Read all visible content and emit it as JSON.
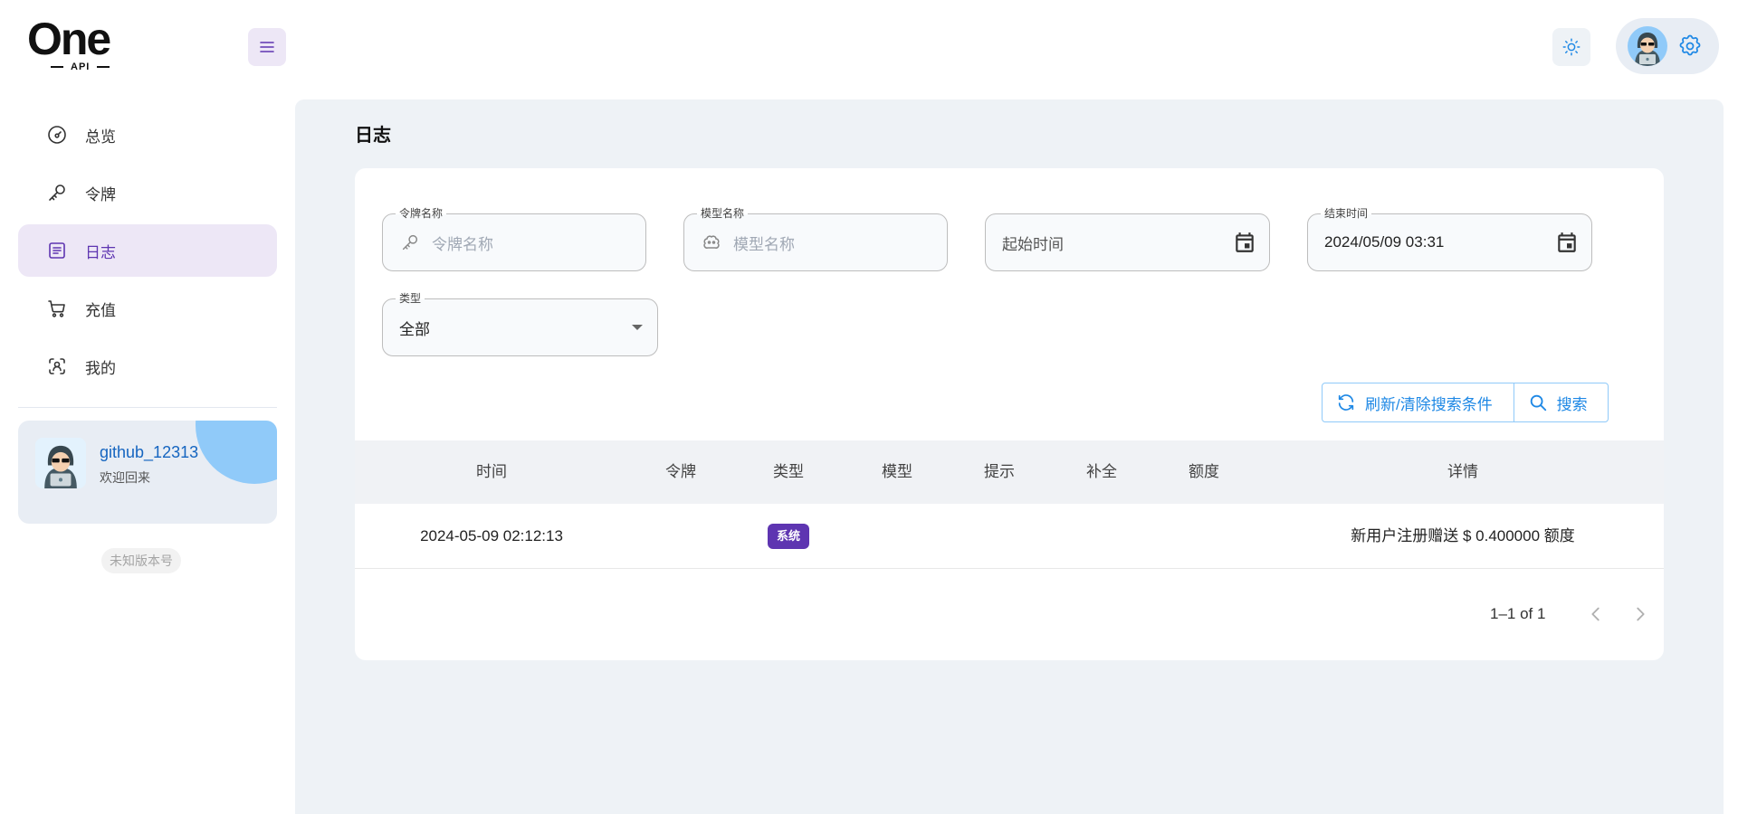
{
  "brand": {
    "logo_main": "One",
    "logo_sub": "API"
  },
  "header": {
    "menu_icon": "hamburger-menu-icon",
    "theme_icon": "sun-icon",
    "settings_icon": "gear-icon"
  },
  "sidebar": {
    "items": [
      {
        "label": "总览",
        "icon": "dashboard-gauge-icon",
        "active": false
      },
      {
        "label": "令牌",
        "icon": "key-icon",
        "active": false
      },
      {
        "label": "日志",
        "icon": "article-list-icon",
        "active": true
      },
      {
        "label": "充值",
        "icon": "shopping-cart-icon",
        "active": false
      },
      {
        "label": "我的",
        "icon": "user-scan-icon",
        "active": false
      }
    ],
    "user": {
      "name": "github_12313",
      "subtitle": "欢迎回来"
    },
    "version": "未知版本号"
  },
  "page": {
    "title": "日志"
  },
  "filters": {
    "token_name": {
      "label": "令牌名称",
      "placeholder": "令牌名称"
    },
    "model_name": {
      "label": "模型名称",
      "placeholder": "模型名称"
    },
    "start_time": {
      "placeholder": "起始时间"
    },
    "end_time": {
      "label": "结束时间",
      "value": "2024/05/09 03:31"
    },
    "type": {
      "label": "类型",
      "value": "全部"
    }
  },
  "actions": {
    "refresh_label": "刷新/清除搜索条件",
    "search_label": "搜索"
  },
  "table": {
    "columns": [
      "时间",
      "令牌",
      "类型",
      "模型",
      "提示",
      "补全",
      "额度",
      "详情"
    ],
    "rows": [
      {
        "time": "2024-05-09 02:12:13",
        "token": "",
        "type": "系统",
        "model": "",
        "prompt": "",
        "completion": "",
        "quota": "",
        "detail": "新用户注册赠送 $ 0.400000 额度"
      }
    ]
  },
  "pagination": {
    "text": "1–1 of 1"
  },
  "colors": {
    "accent": "#5e35b1",
    "accent_light": "#ede7f6",
    "primary_blue": "#1e88e5",
    "main_bg": "#eef2f6"
  }
}
